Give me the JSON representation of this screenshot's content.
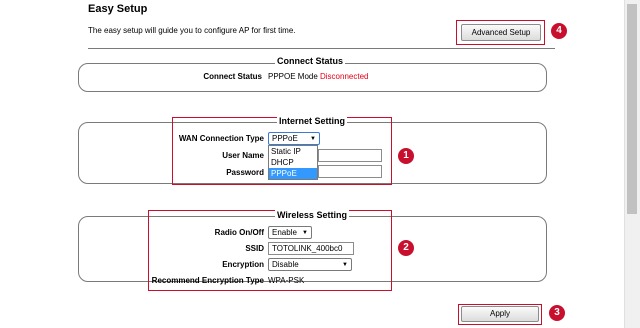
{
  "header": {
    "title": "Easy Setup",
    "description": "The easy setup will guide you to configure AP for first time.",
    "advanced_button": "Advanced Setup"
  },
  "connect_status": {
    "legend": "Connect Status",
    "label": "Connect Status",
    "mode": "PPPOE Mode",
    "status": "Disconnected",
    "status_color": "#e3001b"
  },
  "internet_setting": {
    "legend": "Internet Setting",
    "wan_label": "WAN Connection Type",
    "wan_value": "PPPoE",
    "wan_options": [
      "Static IP",
      "DHCP",
      "PPPoE"
    ],
    "username_label": "User Name",
    "password_label": "Password"
  },
  "wireless_setting": {
    "legend": "Wireless Setting",
    "radio_label": "Radio On/Off",
    "radio_value": "Enable",
    "ssid_label": "SSID",
    "ssid_value": "TOTOLINK_400bc0",
    "encryption_label": "Encryption",
    "encryption_value": "Disable",
    "recommend_label": "Recommend Encryption Type",
    "recommend_value": "WPA-PSK"
  },
  "apply_button": "Apply",
  "callouts": [
    "1",
    "2",
    "3",
    "4"
  ],
  "accent_color": "#c8102e"
}
